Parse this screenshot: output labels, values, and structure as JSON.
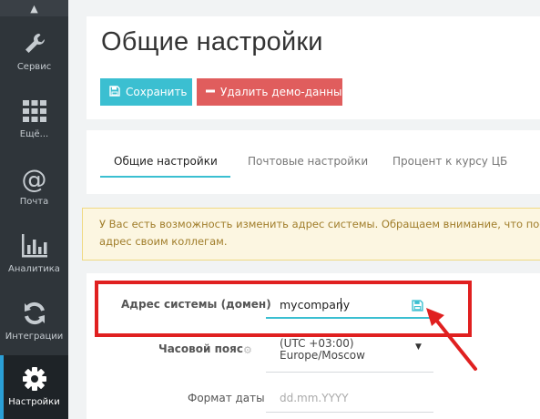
{
  "sidebar": {
    "items": [
      {
        "label": "Сервис",
        "icon": "wrench-icon"
      },
      {
        "label": "Ещё...",
        "icon": "grid-icon"
      },
      {
        "label": "Почта",
        "icon": "at-icon"
      },
      {
        "label": "Аналитика",
        "icon": "bar-chart-icon"
      },
      {
        "label": "Интеграции",
        "icon": "sync-icon"
      },
      {
        "label": "Настройки",
        "icon": "gear-icon"
      }
    ],
    "active": "Настройки"
  },
  "page": {
    "title": "Общие настройки",
    "save_label": "Сохранить",
    "delete_label": "Удалить демо-данные"
  },
  "tabs": [
    {
      "label": "Общие настройки",
      "active": true
    },
    {
      "label": "Почтовые настройки",
      "active": false
    },
    {
      "label": "Процент к курсу ЦБ",
      "active": false
    }
  ],
  "alert": {
    "line1": "У Вас есть возможность изменить адрес системы. Обращаем внимание, что посл",
    "line2": "адрес своим коллегам."
  },
  "form": {
    "domain_label": "Адрес системы (домен)",
    "domain_value": "mycompany",
    "timezone_label": "Часовой пояс",
    "timezone_line1": "(UTC +03:00)",
    "timezone_line2": "Europe/Moscow",
    "date_format_label": "Формат даты",
    "date_format_placeholder": "dd.mm.YYYY"
  },
  "colors": {
    "accent": "#3bbfd1",
    "danger": "#e05d5d",
    "sidebar": "#2f353a",
    "highlight": "#e02020"
  }
}
